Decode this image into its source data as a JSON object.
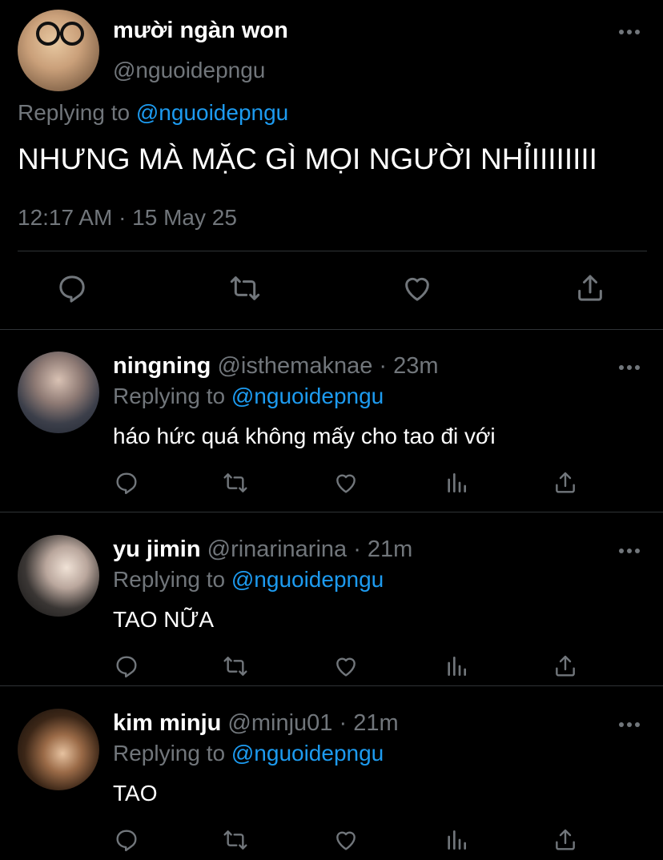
{
  "main_tweet": {
    "display_name": "mười ngàn won",
    "handle": "@nguoidepngu",
    "replying_label": "Replying to",
    "replying_to": "@nguoidepngu",
    "text": "NHƯNG MÀ MẶC GÌ MỌI NGƯỜI NHỈIIIIIIII",
    "timestamp": "12:17 AM · 15 May 25",
    "actions": [
      "reply-icon",
      "retweet-icon",
      "like-icon",
      "share-icon"
    ]
  },
  "replies": [
    {
      "display_name": "ningning",
      "handle": "@isthemaknae · 23m",
      "replying_label": "Replying to",
      "replying_to": "@nguoidepngu",
      "text": "háo hức quá không mấy cho tao đi với"
    },
    {
      "display_name": "yu jimin",
      "handle": "@rinarinarina · 21m",
      "replying_label": "Replying to",
      "replying_to": "@nguoidepngu",
      "text": "TAO NỮA"
    },
    {
      "display_name": "kim minju",
      "handle": "@minju01 · 21m",
      "replying_label": "Replying to",
      "replying_to": "@nguoidepngu",
      "text": "TAO"
    }
  ],
  "colors": {
    "background": "#000000",
    "primary_text": "#ffffff",
    "secondary_text": "#71767b",
    "accent": "#1d9bf0",
    "divider": "#2f3336"
  }
}
